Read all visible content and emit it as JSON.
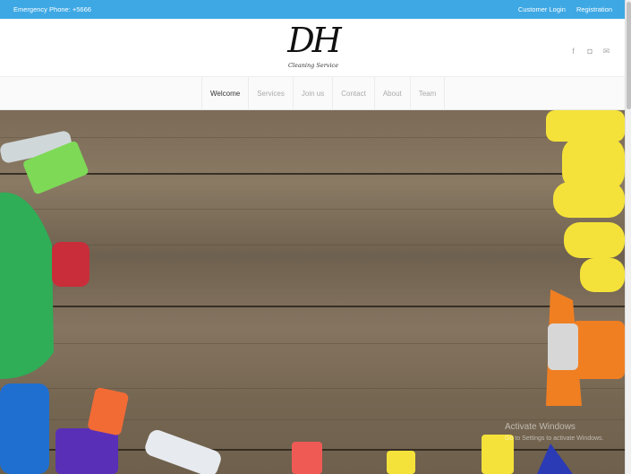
{
  "topbar": {
    "phone": "Emergency Phone: +5666",
    "customer_login": "Customer Login",
    "registration": "Registration"
  },
  "logo": {
    "mark": "DH",
    "tagline": "Cleaning Service"
  },
  "social": {
    "icons": [
      "facebook-icon",
      "instagram-icon",
      "mail-icon"
    ]
  },
  "nav": {
    "items": [
      "Welcome",
      "Services",
      "Join us",
      "Contact",
      "About",
      "Team"
    ],
    "active": "Welcome"
  },
  "watermark": {
    "line1": "Activate Windows",
    "line2": "Go to Settings to activate Windows."
  },
  "colors": {
    "topbar": "#3ea8e4",
    "brush_green": "#7ed957",
    "bottle_green": "#2fae57",
    "cap_red": "#c92d3a",
    "glove_yellow": "#f4e23a",
    "spray_orange": "#f07f22",
    "sponge_blue": "#1f6fd1"
  }
}
